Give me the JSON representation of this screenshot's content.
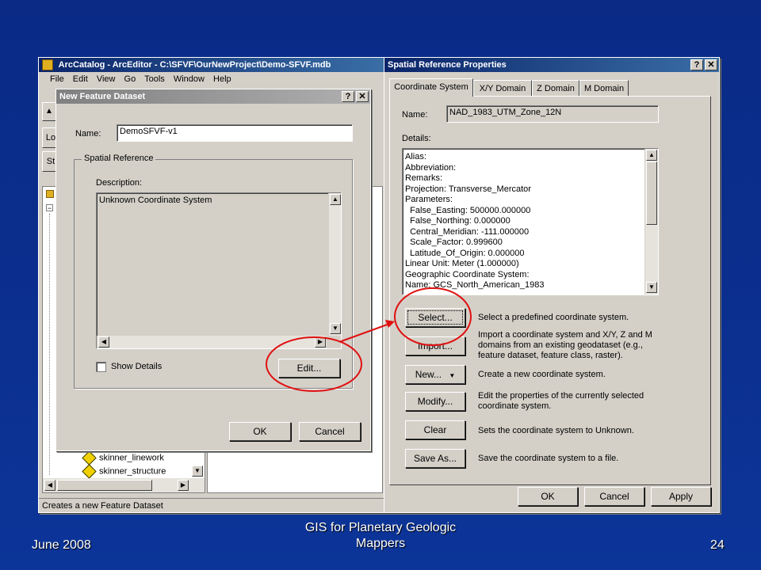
{
  "arccatalog": {
    "title": "ArcCatalog - ArcEditor - C:\\SFVF\\OurNewProject\\Demo-SFVF.mdb",
    "menu": [
      "File",
      "Edit",
      "View",
      "Go",
      "Tools",
      "Window",
      "Help"
    ],
    "side_letters": [
      "Lo",
      "St"
    ],
    "tree_items": [
      "skinner_linework",
      "skinner_structure"
    ],
    "status_text": "Creates a new Feature Dataset"
  },
  "new_feature_dataset": {
    "title": "New Feature Dataset",
    "name_label": "Name:",
    "name_value": "DemoSFVF-v1",
    "group_label": "Spatial Reference",
    "description_label": "Description:",
    "description_value": "Unknown Coordinate System",
    "show_details_label": "Show Details",
    "edit_label": "Edit...",
    "ok_label": "OK",
    "cancel_label": "Cancel"
  },
  "spatial_reference": {
    "title": "Spatial Reference Properties",
    "tabs": [
      "Coordinate System",
      "X/Y Domain",
      "Z Domain",
      "M Domain"
    ],
    "name_label": "Name:",
    "name_value": "NAD_1983_UTM_Zone_12N",
    "details_label": "Details:",
    "details": [
      "Alias:",
      "Abbreviation:",
      "Remarks:",
      "Projection: Transverse_Mercator",
      "Parameters:",
      "  False_Easting: 500000.000000",
      "  False_Northing: 0.000000",
      "  Central_Meridian: -111.000000",
      "  Scale_Factor: 0.999600",
      "  Latitude_Of_Origin: 0.000000",
      "Linear Unit: Meter (1.000000)",
      "Geographic Coordinate System:",
      "Name: GCS_North_American_1983"
    ],
    "actions": [
      {
        "label": "Select...",
        "desc": "Select a predefined coordinate system."
      },
      {
        "label": "Import...",
        "desc": "Import a coordinate system and X/Y, Z and M domains from an existing geodataset (e.g., feature dataset, feature class, raster)."
      },
      {
        "label": "New...",
        "desc": "Create a new coordinate system."
      },
      {
        "label": "Modify...",
        "desc": "Edit the properties of the currently selected coordinate system."
      },
      {
        "label": "Clear",
        "desc": "Sets the coordinate system to Unknown."
      },
      {
        "label": "Save As...",
        "desc": "Save the coordinate system to a file."
      }
    ],
    "ok_label": "OK",
    "cancel_label": "Cancel",
    "apply_label": "Apply"
  },
  "footer": {
    "date": "June 2008",
    "title_line1": "GIS for Planetary Geologic",
    "title_line2": "Mappers",
    "page": "24"
  },
  "colors": {
    "annotation_red": "#e01010",
    "title_bar": "#0a246a",
    "window_face": "#d4d0c8"
  }
}
